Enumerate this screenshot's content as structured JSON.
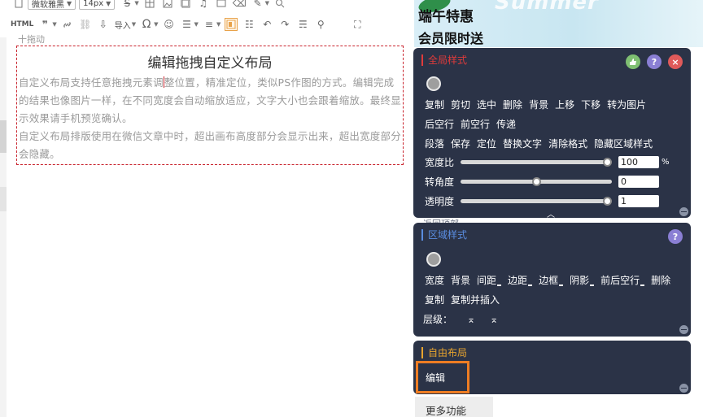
{
  "toolbar": {
    "font_family": "微软雅黑",
    "font_size": "14px",
    "html_label": "HTML",
    "import_label": "导入",
    "drag_tag": "十拖动"
  },
  "layout": {
    "title": "编辑拖拽自定义布局",
    "para1_before_cursor": "自定义布局支持任意拖拽元素调",
    "para1_after_cursor": "整位置，精准定位，类似PS作图的方式。编辑完成的结果也像图片一样，在不同宽度会自动缩放适应，文字大小也会跟着缩放。最终显示效果请手机预览确认。",
    "para2": "自定义布局排版使用在微信文章中时，超出画布高度部分会显示出来，超出宽度部分会隐藏。"
  },
  "banner": {
    "line1": "端午特惠",
    "line2": "会员限时送",
    "deco_text": "Summer"
  },
  "global_style": {
    "title": "全局样式",
    "help_icon": "?",
    "close_icon": "×",
    "row1": [
      "复制",
      "剪切",
      "选中",
      "删除",
      "背景",
      "上移",
      "下移",
      "转为图片"
    ],
    "row2": [
      "后空行",
      "前空行",
      "传递"
    ],
    "row3": [
      "段落",
      "保存",
      "定位",
      "替换文字",
      "清除格式",
      "隐藏区域样式"
    ],
    "width_ratio": {
      "label": "宽度比",
      "value": "100",
      "unit": "%",
      "level": 1.0
    },
    "rotation": {
      "label": "转角度",
      "value": "0",
      "level": 0.5
    },
    "opacity": {
      "label": "透明度",
      "value": "1",
      "level": 1.0
    },
    "collapse_icon": "︿"
  },
  "behind_text": "返回顶部",
  "region_style": {
    "title": "区域样式",
    "help_icon": "?",
    "row1": [
      "宽度",
      "背景",
      "间距",
      "边距",
      "边框",
      "阴影",
      "前后空行",
      "删除"
    ],
    "row1_dropdowns": [
      false,
      false,
      true,
      true,
      true,
      true,
      true,
      false
    ],
    "row2": [
      "复制",
      "复制并插入"
    ],
    "layer_label": "层级：",
    "layer_up_icon": "⌅",
    "layer_top_icon": "⌅"
  },
  "free_layout": {
    "title": "自由布局",
    "edit_label": "编辑"
  },
  "more_functions": "更多功能",
  "colors": {
    "panel_bg": "#2b3347",
    "global_title": "#e03b3b",
    "region_title": "#5a8de0",
    "free_title": "#e8a42e",
    "edit_highlight": "#ee7d23",
    "layout_border": "#c9252f"
  }
}
